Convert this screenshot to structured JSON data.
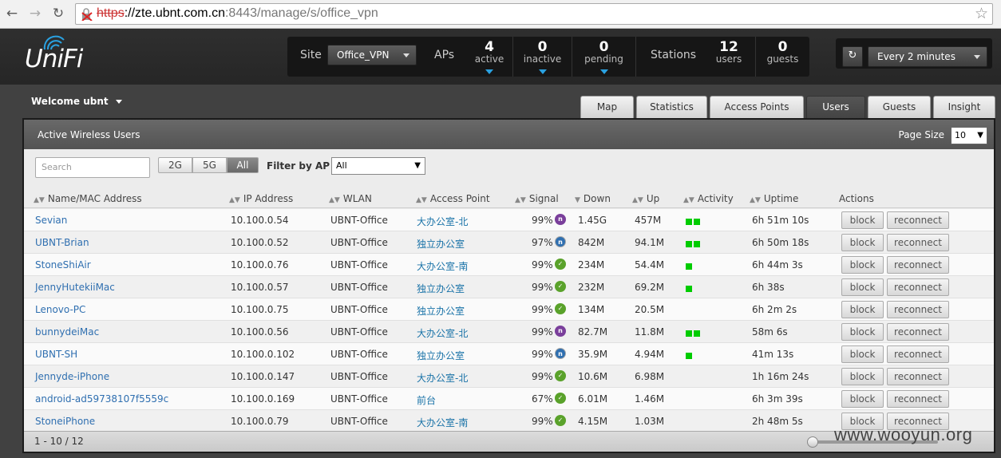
{
  "browser": {
    "url_protocol": "https",
    "url_host": "://zte.ubnt.com.cn",
    "url_path": ":8443/manage/s/office_vpn"
  },
  "app": {
    "logo": "UniFi",
    "site_label": "Site",
    "site_value": "Office_VPN",
    "aps_label": "APs",
    "stations_label": "Stations",
    "stats": [
      {
        "n": "4",
        "l": "active"
      },
      {
        "n": "0",
        "l": "inactive"
      },
      {
        "n": "0",
        "l": "pending"
      },
      {
        "n": "12",
        "l": "users"
      },
      {
        "n": "0",
        "l": "guests"
      }
    ],
    "refresh_label": "Every 2 minutes",
    "welcome": "Welcome ubnt"
  },
  "tabs": [
    "Map",
    "Statistics",
    "Access Points",
    "Users",
    "Guests",
    "Insight"
  ],
  "active_tab": "Users",
  "panel": {
    "title": "Active Wireless Users",
    "page_size_label": "Page Size",
    "page_size_value": "10",
    "search_placeholder": "Search",
    "bands": [
      "2G",
      "5G",
      "All"
    ],
    "filter_label": "Filter by AP",
    "filter_value": "All",
    "columns": [
      "Name/MAC Address",
      "IP Address",
      "WLAN",
      "Access Point",
      "Signal",
      "Down",
      "Up",
      "Activity",
      "Uptime",
      "Actions"
    ],
    "rows": [
      {
        "name": "Sevian",
        "ip": "10.100.0.54",
        "wlan": "UBNT-Office",
        "ap": "大办公室-北",
        "sig": "99%",
        "radio": "n",
        "down": "1.45G",
        "up": "457M",
        "act": 2,
        "uptime": "6h 51m 10s"
      },
      {
        "name": "UBNT-Brian",
        "ip": "10.100.0.52",
        "wlan": "UBNT-Office",
        "ap": "独立办公室",
        "sig": "97%",
        "radio": "n-blue",
        "down": "842M",
        "up": "94.1M",
        "act": 2,
        "uptime": "6h 50m 18s"
      },
      {
        "name": "StoneShiAir",
        "ip": "10.100.0.76",
        "wlan": "UBNT-Office",
        "ap": "大办公室-南",
        "sig": "99%",
        "radio": "ng",
        "down": "234M",
        "up": "54.4M",
        "act": 1,
        "uptime": "6h 44m 3s"
      },
      {
        "name": "JennyHutekiiMac",
        "ip": "10.100.0.57",
        "wlan": "UBNT-Office",
        "ap": "独立办公室",
        "sig": "99%",
        "radio": "ng",
        "down": "232M",
        "up": "69.2M",
        "act": 1,
        "uptime": "6h 38s"
      },
      {
        "name": "Lenovo-PC",
        "ip": "10.100.0.75",
        "wlan": "UBNT-Office",
        "ap": "独立办公室",
        "sig": "99%",
        "radio": "ng-blue",
        "down": "134M",
        "up": "20.5M",
        "act": 0,
        "uptime": "6h 2m 2s"
      },
      {
        "name": "bunnydeiMac",
        "ip": "10.100.0.56",
        "wlan": "UBNT-Office",
        "ap": "大办公室-北",
        "sig": "99%",
        "radio": "n",
        "down": "82.7M",
        "up": "11.8M",
        "act": 2,
        "uptime": "58m 6s"
      },
      {
        "name": "UBNT-SH",
        "ip": "10.100.0.102",
        "wlan": "UBNT-Office",
        "ap": "独立办公室",
        "sig": "99%",
        "radio": "n-blue",
        "down": "35.9M",
        "up": "4.94M",
        "act": 1,
        "uptime": "41m 13s"
      },
      {
        "name": "Jennyde-iPhone",
        "ip": "10.100.0.147",
        "wlan": "UBNT-Office",
        "ap": "大办公室-北",
        "sig": "99%",
        "radio": "ng",
        "down": "10.6M",
        "up": "6.98M",
        "act": 0,
        "uptime": "1h 16m 24s"
      },
      {
        "name": "android-ad59738107f5559c",
        "ip": "10.100.0.169",
        "wlan": "UBNT-Office",
        "ap": "前台",
        "sig": "67%",
        "radio": "ng-blue",
        "down": "6.01M",
        "up": "1.46M",
        "act": 0,
        "uptime": "6h 3m 39s"
      },
      {
        "name": "StoneiPhone",
        "ip": "10.100.0.79",
        "wlan": "UBNT-Office",
        "ap": "大办公室-南",
        "sig": "99%",
        "radio": "ng",
        "down": "4.15M",
        "up": "1.03M",
        "act": 0,
        "uptime": "2h 48m 5s"
      }
    ],
    "block_label": "block",
    "reconnect_label": "reconnect",
    "footer_count": "1 - 10 / 12"
  },
  "watermark": "www.wooyun.org"
}
